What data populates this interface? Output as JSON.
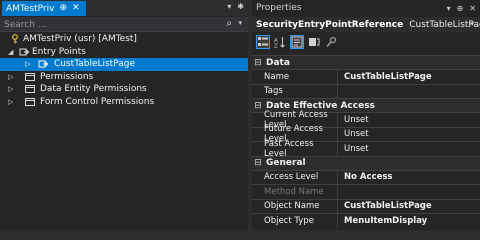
{
  "left_pane": {
    "tab_title": "AMTestPriv",
    "pin_glyph": "⊕",
    "close_glyph": "✕",
    "header_controls": [
      "▾",
      "✱"
    ],
    "search_placeholder": "Search ...",
    "tree": [
      {
        "label": "AMTestPriv (usr) [AMTest]",
        "level": 0,
        "expander": "",
        "icon": "key-icon"
      },
      {
        "label": "Entry Points",
        "level": 1,
        "expander": "◢",
        "icon": "entry-point-icon"
      },
      {
        "label": "CustTableListPage",
        "level": 2,
        "expander": "▷",
        "icon": "entry-point-icon",
        "selected": true
      },
      {
        "label": "Permissions",
        "level": 1,
        "expander": "▷",
        "icon": "folder-icon"
      },
      {
        "label": "Data Entity Permissions",
        "level": 1,
        "expander": "▷",
        "icon": "folder-icon"
      },
      {
        "label": "Form Control Permissions",
        "level": 1,
        "expander": "▷",
        "icon": "folder-icon"
      }
    ]
  },
  "properties": {
    "title": "Properties",
    "controls": [
      "▾",
      "⊕",
      "✕"
    ],
    "object_type": "SecurityEntryPointReference",
    "object_name": "CustTableListPage",
    "categories": [
      {
        "name": "Data",
        "rows": [
          {
            "name": "Name",
            "value": "CustTableListPage",
            "bold": true
          },
          {
            "name": "Tags",
            "value": ""
          }
        ]
      },
      {
        "name": "Date Effective Access",
        "rows": [
          {
            "name": "Current Access Level",
            "value": "Unset"
          },
          {
            "name": "Future Access Level",
            "value": "Unset"
          },
          {
            "name": "Past Access Level",
            "value": "Unset"
          }
        ]
      },
      {
        "name": "General",
        "rows": [
          {
            "name": "Access Level",
            "value": "No Access",
            "bold": true
          },
          {
            "name": "Method Name",
            "value": "",
            "disabled": true
          },
          {
            "name": "Object Name",
            "value": "CustTableListPage",
            "bold": true
          },
          {
            "name": "Object Type",
            "value": "MenuItemDisplay",
            "bold": true
          }
        ]
      }
    ]
  },
  "colors": {
    "accent": "#007acc",
    "bg": "#252526",
    "panel": "#2d2d30"
  }
}
